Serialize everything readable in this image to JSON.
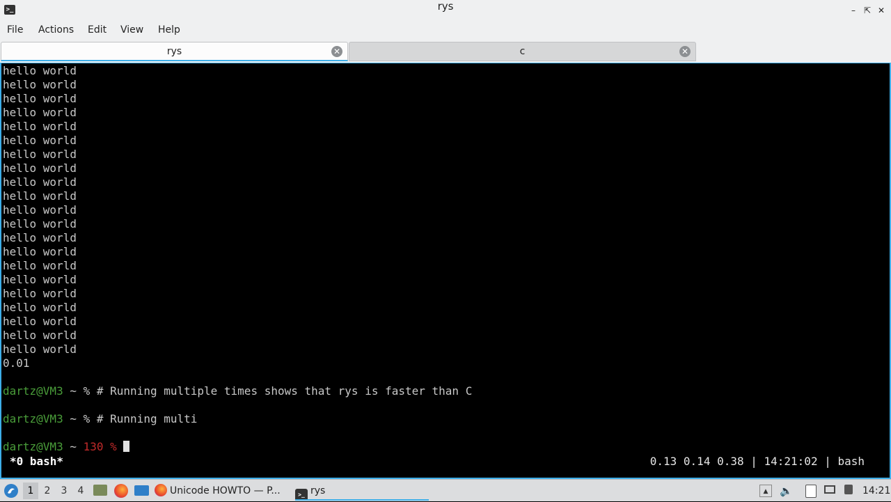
{
  "window": {
    "title": "rys"
  },
  "menu": {
    "items": [
      "File",
      "Actions",
      "Edit",
      "View",
      "Help"
    ]
  },
  "tabs": [
    {
      "label": "rys"
    },
    {
      "label": "c"
    }
  ],
  "terminal": {
    "output_lines": [
      "hello world",
      "hello world",
      "hello world",
      "hello world",
      "hello world",
      "hello world",
      "hello world",
      "hello world",
      "hello world",
      "hello world",
      "hello world",
      "hello world",
      "hello world",
      "hello world",
      "hello world",
      "hello world",
      "hello world",
      "hello world",
      "hello world",
      "hello world",
      "hello world",
      "0.01"
    ],
    "prompts": [
      {
        "user_host": "dartz@VM3",
        "sep": " ~ ",
        "code": "",
        "symbol": "%",
        "command": " # Running multiple times shows that rys is faster than C"
      },
      {
        "user_host": "dartz@VM3",
        "sep": " ~ ",
        "code": "",
        "symbol": "%",
        "command": " # Running multi"
      },
      {
        "user_host": "dartz@VM3",
        "sep": " ~ ",
        "code": "130 %",
        "symbol": "",
        "command": " "
      }
    ],
    "status_left": "*0 bash*",
    "status_right": "0.13 0.14 0.38 | 14:21:02 | bash"
  },
  "taskbar": {
    "workspaces": [
      "1",
      "2",
      "3",
      "4"
    ],
    "tasks": [
      {
        "label": "Unicode HOWTO — P..."
      },
      {
        "label": "rys"
      }
    ],
    "clock": "14:21"
  },
  "colors": {
    "accent": "#3daee9",
    "prompt_green": "#4a9e3a",
    "error_red": "#c22a2a"
  }
}
